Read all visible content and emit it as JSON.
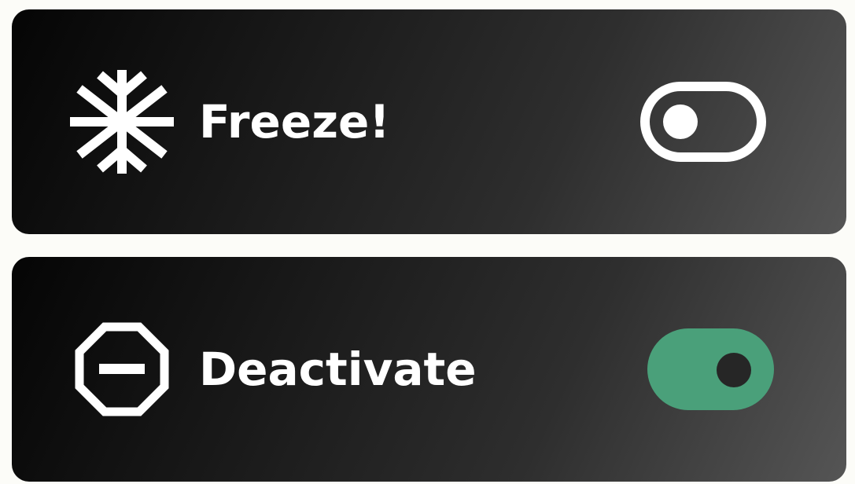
{
  "settings": [
    {
      "label": "Freeze!",
      "icon": "snowflake-icon",
      "toggle_state": "off"
    },
    {
      "label": "Deactivate",
      "icon": "octagon-minus-icon",
      "toggle_state": "on"
    }
  ],
  "colors": {
    "toggle_on": "#4aa07a",
    "toggle_off_outline": "#ffffff",
    "card_gradient_start": "#050505",
    "card_gradient_end": "#555555",
    "text": "#ffffff"
  }
}
